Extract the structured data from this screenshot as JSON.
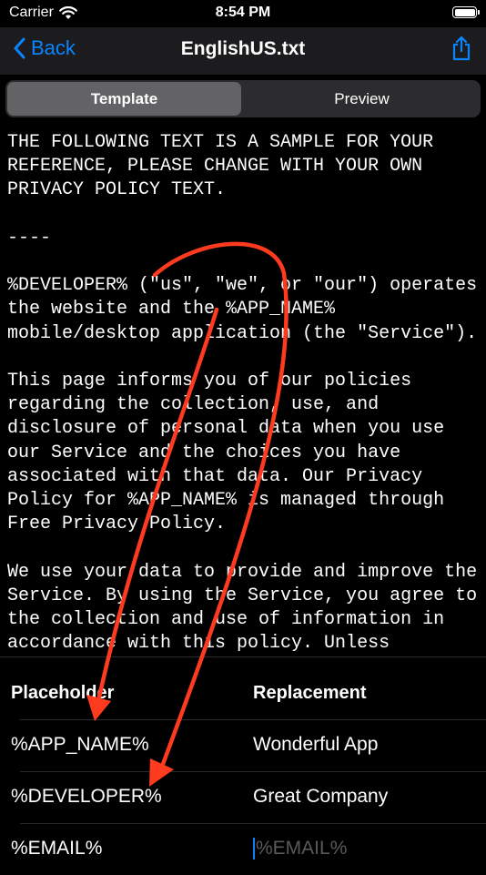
{
  "status": {
    "carrier": "Carrier",
    "time": "8:54 PM"
  },
  "nav": {
    "back_label": "Back",
    "title": "EnglishUS.txt"
  },
  "tabs": [
    {
      "label": "Template",
      "selected": true
    },
    {
      "label": "Preview",
      "selected": false
    }
  ],
  "document": {
    "text": "THE FOLLOWING TEXT IS A SAMPLE FOR YOUR REFERENCE, PLEASE CHANGE WITH YOUR OWN PRIVACY POLICY TEXT.\n\n----\n\n%DEVELOPER% (\"us\", \"we\", or \"our\") operates the website and the %APP_NAME% mobile/desktop application (the \"Service\").\n\nThis page informs you of our policies regarding the collection, use, and disclosure of personal data when you use our Service and the choices you have associated with that data. Our Privacy Policy for %APP_NAME% is managed through Free Privacy Policy.\n\nWe use your data to provide and improve the Service. By using the Service, you agree to the collection and use of information in accordance with this policy. Unless otherwise defined in this Privacy Policy, terms used in this Privacy Policy have the"
  },
  "table": {
    "header_placeholder": "Placeholder",
    "header_replacement": "Replacement",
    "rows": [
      {
        "placeholder": "%APP_NAME%",
        "replacement": "Wonderful App"
      },
      {
        "placeholder": "%DEVELOPER%",
        "replacement": "Great Company"
      },
      {
        "placeholder": "%EMAIL%",
        "replacement": "",
        "replacement_placeholder": "%EMAIL%"
      }
    ]
  },
  "colors": {
    "accent": "#0a84ff",
    "arrow": "#ff3b1f",
    "background": "#000000",
    "bar": "#1c1c1e"
  }
}
